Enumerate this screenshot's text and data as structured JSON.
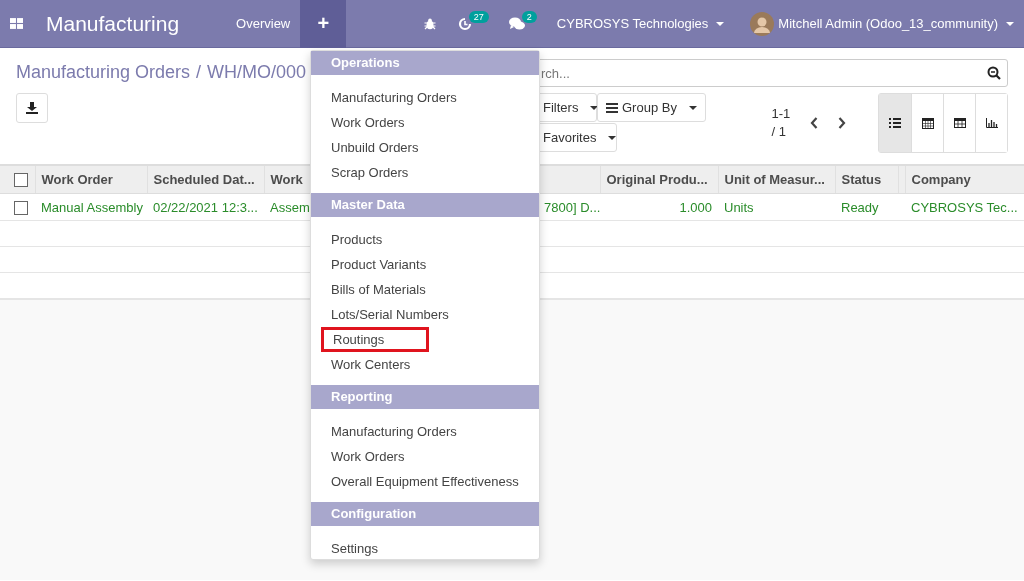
{
  "navbar": {
    "app_title": "Manufacturing",
    "links": [
      {
        "label": "Overview"
      }
    ],
    "plus": {
      "label": "+",
      "expanded": true
    },
    "activity_badge": "27",
    "messages_badge": "2",
    "company": "CYBROSYS Technologies",
    "user": "Mitchell Admin (Odoo_13_community)"
  },
  "breadcrumb": {
    "items": [
      "Manufacturing Orders",
      "WH/MO/000"
    ],
    "separator": "/"
  },
  "search": {
    "placeholder": "rch..."
  },
  "filters": [
    {
      "label": "Filters",
      "kind": "filter"
    },
    {
      "label": "Group By",
      "kind": "group"
    },
    {
      "label": "Favorites",
      "kind": "favorite"
    }
  ],
  "pager": {
    "range": "1-1",
    "total": "/ 1"
  },
  "views": [
    {
      "kind": "list",
      "selected": true
    },
    {
      "kind": "calendar",
      "selected": false
    },
    {
      "kind": "pivot",
      "selected": false
    },
    {
      "kind": "graph",
      "selected": false
    }
  ],
  "table": {
    "select_all_checked": false,
    "columns": [
      "Work Order",
      "Scheduled Dat...",
      "Work",
      "",
      "Original Produ...",
      "Unit of Measur...",
      "Status",
      "",
      "Company"
    ],
    "rows": [
      {
        "checked": false,
        "cells": [
          "Manual Assembly",
          "02/22/2021 12:3...",
          "Assem",
          "7800] D...",
          "1.000",
          "Units",
          "Ready",
          "",
          "CYBROSYS Tec..."
        ]
      }
    ]
  },
  "menu": {
    "sections": [
      {
        "title": "Operations",
        "items": [
          {
            "label": "Manufacturing Orders",
            "highlighted": false
          },
          {
            "label": "Work Orders",
            "highlighted": false
          },
          {
            "label": "Unbuild Orders",
            "highlighted": false
          },
          {
            "label": "Scrap Orders",
            "highlighted": false
          }
        ]
      },
      {
        "title": "Master Data",
        "items": [
          {
            "label": "Products",
            "highlighted": false
          },
          {
            "label": "Product Variants",
            "highlighted": false
          },
          {
            "label": "Bills of Materials",
            "highlighted": false
          },
          {
            "label": "Lots/Serial Numbers",
            "highlighted": false
          },
          {
            "label": "Routings",
            "highlighted": true
          },
          {
            "label": "Work Centers",
            "highlighted": false
          }
        ]
      },
      {
        "title": "Reporting",
        "items": [
          {
            "label": "Manufacturing Orders",
            "highlighted": false
          },
          {
            "label": "Work Orders",
            "highlighted": false
          },
          {
            "label": "Overall Equipment Effectiveness",
            "highlighted": false
          }
        ]
      },
      {
        "title": "Configuration",
        "items": [
          {
            "label": "Settings",
            "highlighted": false
          }
        ]
      }
    ]
  }
}
